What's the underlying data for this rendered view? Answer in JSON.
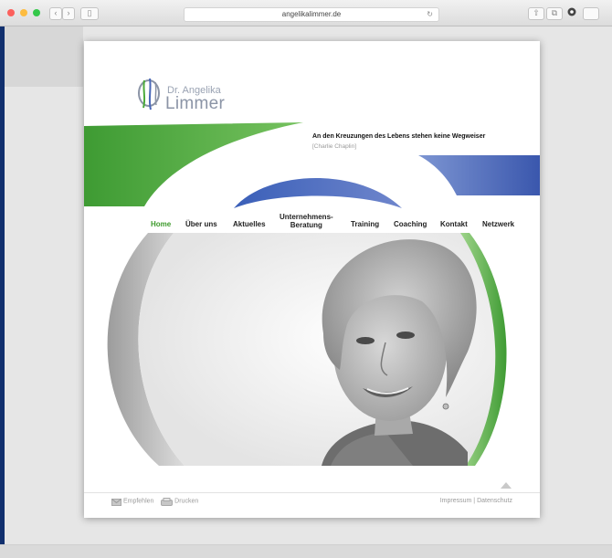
{
  "browser": {
    "url": "angelikalimmer.de"
  },
  "logo": {
    "line1": "Dr. Angelika",
    "line2": "Limmer"
  },
  "banner": {
    "quote": "An den Kreuzungen des Lebens stehen keine Wegweiser",
    "author": "[Charlie Chaplin]"
  },
  "nav": [
    {
      "label": "Home",
      "active": true
    },
    {
      "label": "Über uns"
    },
    {
      "label": "Aktuelles"
    },
    {
      "label": "Unternehmens-",
      "label2": "Beratung"
    },
    {
      "label": "Training"
    },
    {
      "label": "Coaching"
    },
    {
      "label": "Kontakt"
    },
    {
      "label": "Netzwerk"
    }
  ],
  "footer": {
    "recommend": "Empfehlen",
    "print": "Drucken",
    "imprint": "Impressum",
    "separator": "|",
    "privacy": "Datenschutz"
  },
  "colors": {
    "green": "#4caa3b",
    "blue": "#4a68b8",
    "nav_active": "#3d9a2c"
  }
}
